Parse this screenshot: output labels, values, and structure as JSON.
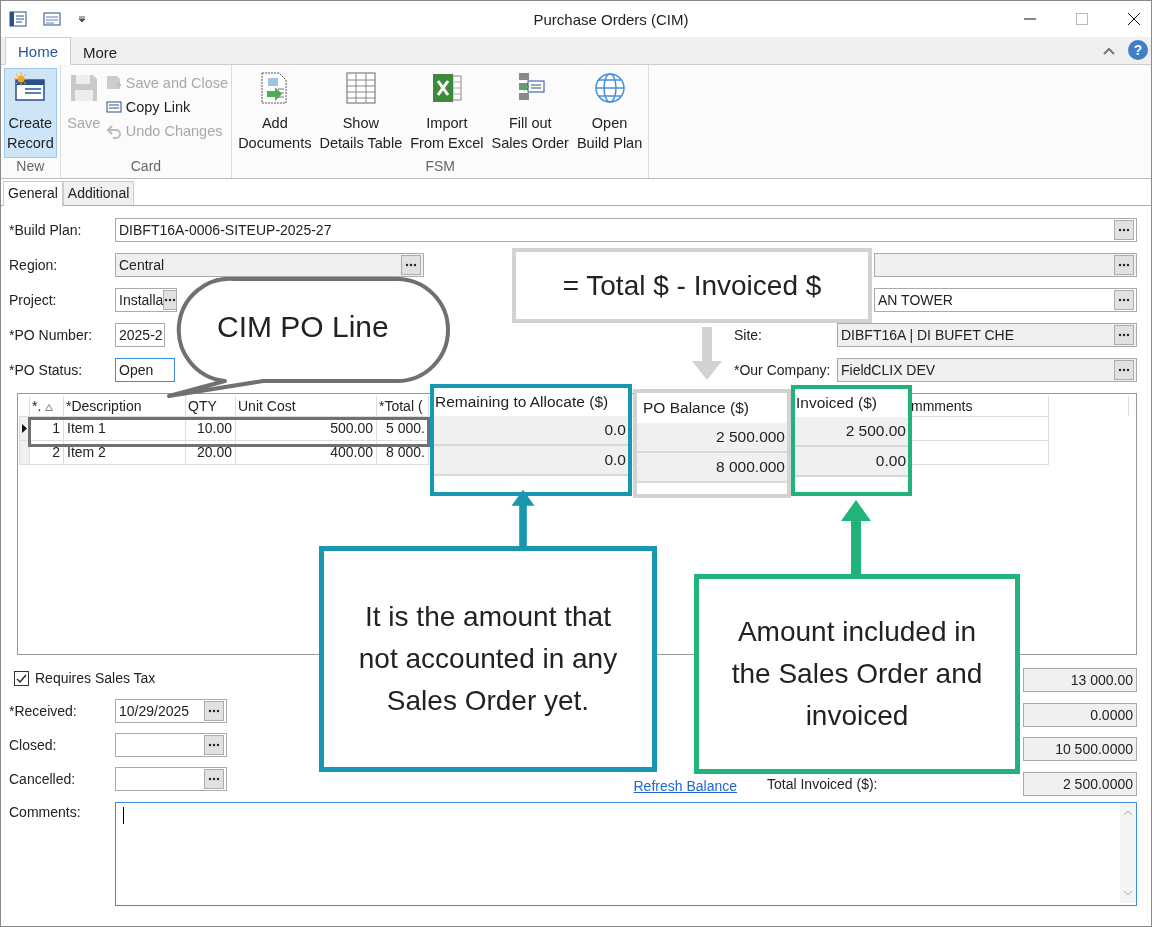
{
  "window": {
    "title": "Purchase Orders (CIM)"
  },
  "ribbon": {
    "tabs": [
      {
        "label": "Home",
        "selected": true
      },
      {
        "label": "More",
        "selected": false
      }
    ],
    "help": "?",
    "groups": [
      {
        "label": "New",
        "items": [
          {
            "label": "Create\nRecord",
            "kind": "large",
            "highlighted": true,
            "disabled": false
          }
        ]
      },
      {
        "label": "Card",
        "items": [
          {
            "label": "Save",
            "kind": "large",
            "highlighted": false,
            "disabled": true
          },
          {
            "label": "Save and Close",
            "kind": "small",
            "highlighted": false,
            "disabled": true
          },
          {
            "label": "Copy Link",
            "kind": "small",
            "highlighted": false,
            "disabled": false
          },
          {
            "label": "Undo Changes",
            "kind": "small",
            "highlighted": false,
            "disabled": true
          }
        ]
      },
      {
        "label": "FSM",
        "items": [
          {
            "label": "Add\nDocuments",
            "kind": "large",
            "highlighted": false,
            "disabled": false
          },
          {
            "label": "Show\nDetails Table",
            "kind": "large",
            "highlighted": false,
            "disabled": false
          },
          {
            "label": "Import\nFrom Excel",
            "kind": "large",
            "highlighted": false,
            "disabled": false
          },
          {
            "label": "Fill out\nSales Order",
            "kind": "large",
            "highlighted": false,
            "disabled": false
          },
          {
            "label": "Open\nBuild Plan",
            "kind": "large",
            "highlighted": false,
            "disabled": false
          }
        ]
      }
    ]
  },
  "form_tabs": [
    {
      "label": "General",
      "selected": true
    },
    {
      "label": "Additional",
      "selected": false
    }
  ],
  "build_plan": {
    "label": "*Build Plan:",
    "value": "DIBFT16A-0006-SITEUP-2025-27"
  },
  "left_fields": [
    {
      "label": "Region:",
      "value": "Central",
      "kind": "lookup",
      "disabled": true
    },
    {
      "label": "Project:",
      "value": "Installa",
      "kind": "lookup",
      "disabled": false
    },
    {
      "label": "*PO Number:",
      "value": "2025-2",
      "kind": "text",
      "disabled": false
    },
    {
      "label": "*PO Status:",
      "value": "Open",
      "kind": "dropdown",
      "disabled": false
    }
  ],
  "right_fields": [
    {
      "disabled": true
    },
    {
      "value": "AN TOWER",
      "disabled": false
    },
    {
      "label": "Site:",
      "value": "DIBFT16A | DI BUFET CHE",
      "disabled": true
    },
    {
      "label": "*Our Company:",
      "value": "FieldCLIX DEV",
      "disabled": true
    }
  ],
  "grid": {
    "columns": [
      "*.",
      "*Description",
      "QTY",
      "Unit Cost",
      "*Total (",
      "mmments"
    ],
    "rows": [
      {
        "number": "1",
        "description": "Item 1",
        "qty": "10.00",
        "unit_cost": "500.00",
        "total": "5 000.",
        "selected": true
      },
      {
        "number": "2",
        "description": "Item 2",
        "qty": "20.00",
        "unit_cost": "400.00",
        "total": "8 000.",
        "selected": false
      }
    ]
  },
  "requires_sales_tax": {
    "label": "Requires Sales Tax",
    "checked": true
  },
  "dates": [
    {
      "label": "*Received:",
      "value": "10/29/2025"
    },
    {
      "label": "Closed:"
    },
    {
      "label": "Cancelled:"
    }
  ],
  "refresh_link": "Refresh Balance",
  "totals": [
    {
      "value": "13 000.00"
    },
    {
      "value": "0.0000"
    },
    {
      "value": "10 500.0000"
    },
    {
      "label": "Total Invoiced ($):",
      "value": "2 500.0000"
    }
  ],
  "comments": {
    "label": "Comments:"
  },
  "annotations": {
    "bubble": "CIM PO Line",
    "formula": "= Total $ - Invoiced $",
    "column_frames": [
      {
        "header": "Remaining to Allocate ($)",
        "color": "#1a97b0",
        "cells": [
          "0.0",
          "0.0"
        ]
      },
      {
        "header": "PO Balance ($)",
        "color": "#d2d2d2",
        "cells": [
          "2 500.000",
          "8 000.000"
        ]
      },
      {
        "header": "Invoiced ($)",
        "color": "#20b47a",
        "cells": [
          "2 500.00",
          "0.00"
        ]
      }
    ],
    "notes": [
      {
        "text": "It is the amount that not accounted in any Sales Order yet.",
        "color": "#1a97b0"
      },
      {
        "text": "Amount included in the Sales Order and invoiced",
        "color": "#20b47a"
      }
    ]
  }
}
